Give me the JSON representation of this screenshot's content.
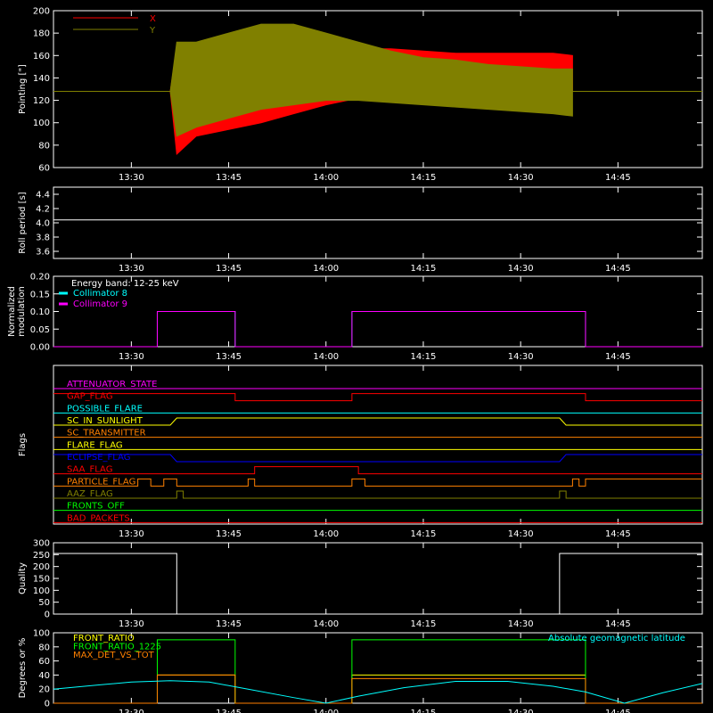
{
  "colors": {
    "background": "#000000",
    "axis": "#ffffff",
    "x": "#ff0000",
    "y": "#808000",
    "white": "#ffffff",
    "cyan": "#00ffff",
    "magenta": "#ff00ff",
    "green": "#00ff00",
    "yellow": "#ffff00",
    "orange": "#ff8000",
    "blue": "#0000ff",
    "red": "#ff0000"
  },
  "time_ticks": [
    "13:30",
    "13:45",
    "14:00",
    "14:15",
    "14:30",
    "14:45"
  ],
  "chart_data": [
    {
      "type": "line",
      "id": "pointing",
      "ylabel": "Pointing [\"]",
      "xlim": [
        "13:18",
        "14:58"
      ],
      "ylim": [
        60,
        200
      ],
      "yticks": [
        60,
        80,
        100,
        120,
        140,
        160,
        180,
        200
      ],
      "legend": [
        "X",
        "Y"
      ],
      "series": [
        {
          "name": "X",
          "color": "#ff0000",
          "x": [
            "13:18",
            "13:36",
            "13:37",
            "13:40",
            "13:45",
            "13:50",
            "13:55",
            "14:00",
            "14:05",
            "14:10",
            "14:15",
            "14:20",
            "14:25",
            "14:30",
            "14:35",
            "14:38",
            "14:38"
          ],
          "y": [
            128,
            128,
            168,
            150,
            154,
            158,
            162,
            166,
            166,
            166,
            164,
            162,
            162,
            162,
            162,
            160,
            128
          ],
          "y_lower": [
            128,
            128,
            72,
            88,
            94,
            100,
            108,
            116,
            122,
            124,
            124,
            126,
            128,
            130,
            132,
            134,
            128
          ]
        },
        {
          "name": "Y",
          "color": "#808000",
          "x": [
            "13:18",
            "13:36",
            "13:37",
            "13:40",
            "13:45",
            "13:50",
            "13:55",
            "14:00",
            "14:05",
            "14:10",
            "14:15",
            "14:20",
            "14:25",
            "14:30",
            "14:35",
            "14:38",
            "14:38",
            "14:58"
          ],
          "y": [
            128,
            128,
            172,
            172,
            180,
            188,
            188,
            180,
            172,
            164,
            158,
            156,
            152,
            150,
            148,
            148,
            128,
            128
          ],
          "y_lower": [
            128,
            128,
            88,
            96,
            104,
            112,
            116,
            120,
            120,
            118,
            116,
            114,
            112,
            110,
            108,
            106,
            128,
            128
          ]
        }
      ]
    },
    {
      "type": "line",
      "id": "roll-period",
      "ylabel": "Roll period [s]",
      "xlim": [
        "13:18",
        "14:58"
      ],
      "ylim": [
        3.5,
        4.5
      ],
      "yticks": [
        3.6,
        3.8,
        4.0,
        4.2,
        4.4
      ],
      "series": [
        {
          "color": "#ffffff",
          "x": [
            "13:18",
            "14:58"
          ],
          "y": [
            4.04,
            4.04
          ]
        }
      ]
    },
    {
      "type": "line",
      "id": "modulation",
      "ylabel": "Normalized modulation",
      "xlim": [
        "13:18",
        "14:58"
      ],
      "ylim": [
        0.0,
        0.2
      ],
      "yticks": [
        0.0,
        0.05,
        0.1,
        0.15,
        0.2
      ],
      "annotation": "Energy band: 12-25 keV",
      "legend": [
        "Collimator 8",
        "Collimator 9"
      ],
      "series": [
        {
          "name": "Collimator 8",
          "color": "#00ffff",
          "x": [
            "13:18",
            "13:34",
            "13:34",
            "13:46",
            "13:46",
            "14:04",
            "14:04",
            "14:40",
            "14:40",
            "14:58"
          ],
          "y": [
            0,
            0,
            0.1,
            0.1,
            0,
            0,
            0.1,
            0.1,
            0,
            0
          ]
        },
        {
          "name": "Collimator 9",
          "color": "#ff00ff",
          "x": [
            "13:18",
            "13:34",
            "13:34",
            "13:46",
            "13:46",
            "14:04",
            "14:04",
            "14:40",
            "14:40",
            "14:58"
          ],
          "y": [
            0,
            0,
            0.1,
            0.1,
            0,
            0,
            0.1,
            0.1,
            0,
            0
          ]
        }
      ]
    },
    {
      "type": "line",
      "id": "flags",
      "ylabel": "Flags",
      "xlim": [
        "13:18",
        "14:58"
      ],
      "series": [
        {
          "name": "ATTENUATOR_STATE",
          "color": "#ff00ff",
          "level": 0,
          "x": [
            "13:18",
            "14:58"
          ],
          "state": [
            0,
            0
          ]
        },
        {
          "name": "GAP_FLAG",
          "color": "#ff0000",
          "level": 1,
          "x": [
            "13:18",
            "13:46",
            "13:46",
            "14:04",
            "14:04",
            "14:40",
            "14:40",
            "14:58"
          ],
          "state": [
            1,
            1,
            0,
            0,
            1,
            1,
            0,
            0
          ]
        },
        {
          "name": "POSSIBLE_FLARE",
          "color": "#00ffff",
          "level": 2,
          "x": [
            "13:18",
            "14:58"
          ],
          "state": [
            0,
            0
          ]
        },
        {
          "name": "SC_IN_SUNLIGHT",
          "color": "#ffff00",
          "level": 3,
          "x": [
            "13:18",
            "13:36",
            "13:37",
            "14:36",
            "14:37",
            "14:58"
          ],
          "state": [
            0,
            0,
            1,
            1,
            0,
            0
          ]
        },
        {
          "name": "SC_TRANSMITTER",
          "color": "#ff8000",
          "level": 4,
          "x": [
            "13:18",
            "14:58"
          ],
          "state": [
            0,
            0
          ]
        },
        {
          "name": "FLARE_FLAG",
          "color": "#ffff00",
          "level": 5,
          "x": [
            "13:18",
            "14:58"
          ],
          "state": [
            0,
            0
          ]
        },
        {
          "name": "ECLIPSE_FLAG",
          "color": "#0000ff",
          "level": 6,
          "x": [
            "13:18",
            "13:36",
            "13:37",
            "14:36",
            "14:37",
            "14:58"
          ],
          "state": [
            1,
            1,
            0,
            0,
            1,
            1
          ]
        },
        {
          "name": "SAA_FLAG",
          "color": "#ff0000",
          "level": 7,
          "x": [
            "13:18",
            "13:49",
            "13:49",
            "14:05",
            "14:05",
            "14:58"
          ],
          "state": [
            0,
            0,
            1,
            1,
            0,
            0
          ]
        },
        {
          "name": "PARTICLE_FLAG",
          "color": "#ff8000",
          "level": 8,
          "x": [
            "13:18",
            "13:31",
            "13:31",
            "13:33",
            "13:33",
            "13:35",
            "13:35",
            "13:37",
            "13:37",
            "13:48",
            "13:48",
            "13:49",
            "13:49",
            "14:04",
            "14:04",
            "14:06",
            "14:06",
            "14:38",
            "14:38",
            "14:39",
            "14:39",
            "14:40",
            "14:40",
            "14:58"
          ],
          "state": [
            0,
            0,
            1,
            1,
            0,
            0,
            1,
            1,
            0,
            0,
            1,
            1,
            0,
            0,
            1,
            1,
            0,
            0,
            1,
            1,
            0,
            0,
            1,
            1
          ]
        },
        {
          "name": "AAZ_FLAG",
          "color": "#808000",
          "level": 9,
          "x": [
            "13:18",
            "13:37",
            "13:37",
            "13:38",
            "13:38",
            "14:36",
            "14:36",
            "14:37",
            "14:37",
            "14:58"
          ],
          "state": [
            0,
            0,
            1,
            1,
            0,
            0,
            1,
            1,
            0,
            0
          ]
        },
        {
          "name": "FRONTS_OFF",
          "color": "#00ff00",
          "level": 10,
          "x": [
            "13:18",
            "14:58"
          ],
          "state": [
            0,
            0
          ]
        },
        {
          "name": "BAD_PACKETS",
          "color": "#ff0000",
          "level": 11,
          "x": [
            "13:18",
            "14:58"
          ],
          "state": [
            0,
            0
          ]
        }
      ]
    },
    {
      "type": "line",
      "id": "quality",
      "ylabel": "Quality",
      "xlim": [
        "13:18",
        "14:58"
      ],
      "ylim": [
        0,
        300
      ],
      "yticks": [
        0,
        50,
        100,
        150,
        200,
        250,
        300
      ],
      "series": [
        {
          "color": "#ffffff",
          "x": [
            "13:18",
            "13:37",
            "13:37",
            "14:36",
            "14:36",
            "14:58"
          ],
          "y": [
            255,
            255,
            0,
            0,
            255,
            255
          ]
        }
      ]
    },
    {
      "type": "line",
      "id": "degrees",
      "ylabel": "Degrees or %",
      "xlim": [
        "13:18",
        "14:58"
      ],
      "ylim": [
        0,
        100
      ],
      "yticks": [
        0,
        20,
        40,
        60,
        80,
        100
      ],
      "legend": [
        "FRONT_RATIO",
        "FRONT_RATIO_1225",
        "MAX_DET_VS_TOT",
        "Absolute geomagnetic latitude"
      ],
      "series": [
        {
          "name": "FRONT_RATIO",
          "color": "#ffff00",
          "x": [
            "13:18",
            "13:34",
            "13:34",
            "13:46",
            "13:46",
            "14:04",
            "14:04",
            "14:40",
            "14:40",
            "14:58"
          ],
          "y": [
            0,
            0,
            40,
            40,
            0,
            0,
            40,
            40,
            0,
            0
          ]
        },
        {
          "name": "FRONT_RATIO_1225",
          "color": "#00ff00",
          "x": [
            "13:18",
            "13:34",
            "13:34",
            "13:46",
            "13:46",
            "14:04",
            "14:04",
            "14:40",
            "14:40",
            "14:58"
          ],
          "y": [
            0,
            0,
            90,
            90,
            0,
            0,
            90,
            90,
            0,
            0
          ]
        },
        {
          "name": "MAX_DET_VS_TOT",
          "color": "#ff8000",
          "x": [
            "13:18",
            "13:34",
            "13:34",
            "13:46",
            "13:46",
            "14:04",
            "14:04",
            "14:40",
            "14:40",
            "14:58"
          ],
          "y": [
            0,
            0,
            40,
            40,
            0,
            0,
            35,
            35,
            0,
            0
          ]
        },
        {
          "name": "Absolute geomagnetic latitude",
          "color": "#00ffff",
          "x": [
            "13:18",
            "13:25",
            "13:30",
            "13:36",
            "13:42",
            "13:48",
            "13:55",
            "14:00",
            "14:05",
            "14:12",
            "14:20",
            "14:28",
            "14:35",
            "14:40",
            "14:46",
            "14:52",
            "14:58"
          ],
          "y": [
            20,
            26,
            30,
            32,
            30,
            20,
            8,
            0,
            10,
            22,
            31,
            31,
            24,
            16,
            0,
            15,
            28
          ]
        }
      ]
    }
  ]
}
